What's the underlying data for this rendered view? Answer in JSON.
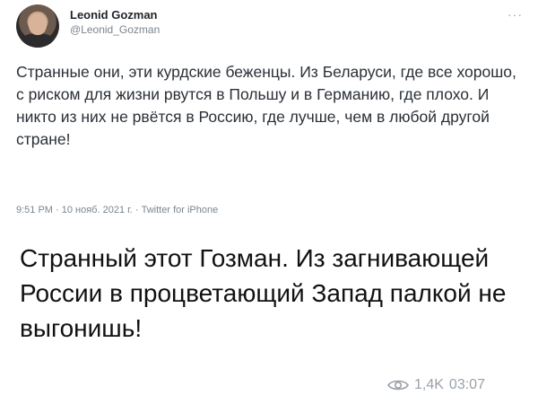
{
  "tweet": {
    "author_name": "Leonid Gozman",
    "author_handle": "@Leonid_Gozman",
    "more_icon": "more-dots-icon",
    "text": "Странные они, эти курдские беженцы. Из Беларуси, где все хорошо, с риском для жизни рвутся в Польшу и в Германию, где плохо. И никто из них не рвётся в Россию, где лучше, чем в любой другой стране!",
    "meta": "9:51 PM · 10 нояб. 2021 г. · Twitter for iPhone"
  },
  "message": {
    "text": "Странный этот Гозман. Из загнивающей России в процветающий Запад палкой не выгонишь!",
    "views": "1,4K",
    "time": "03:07",
    "views_icon": "eye-icon"
  }
}
